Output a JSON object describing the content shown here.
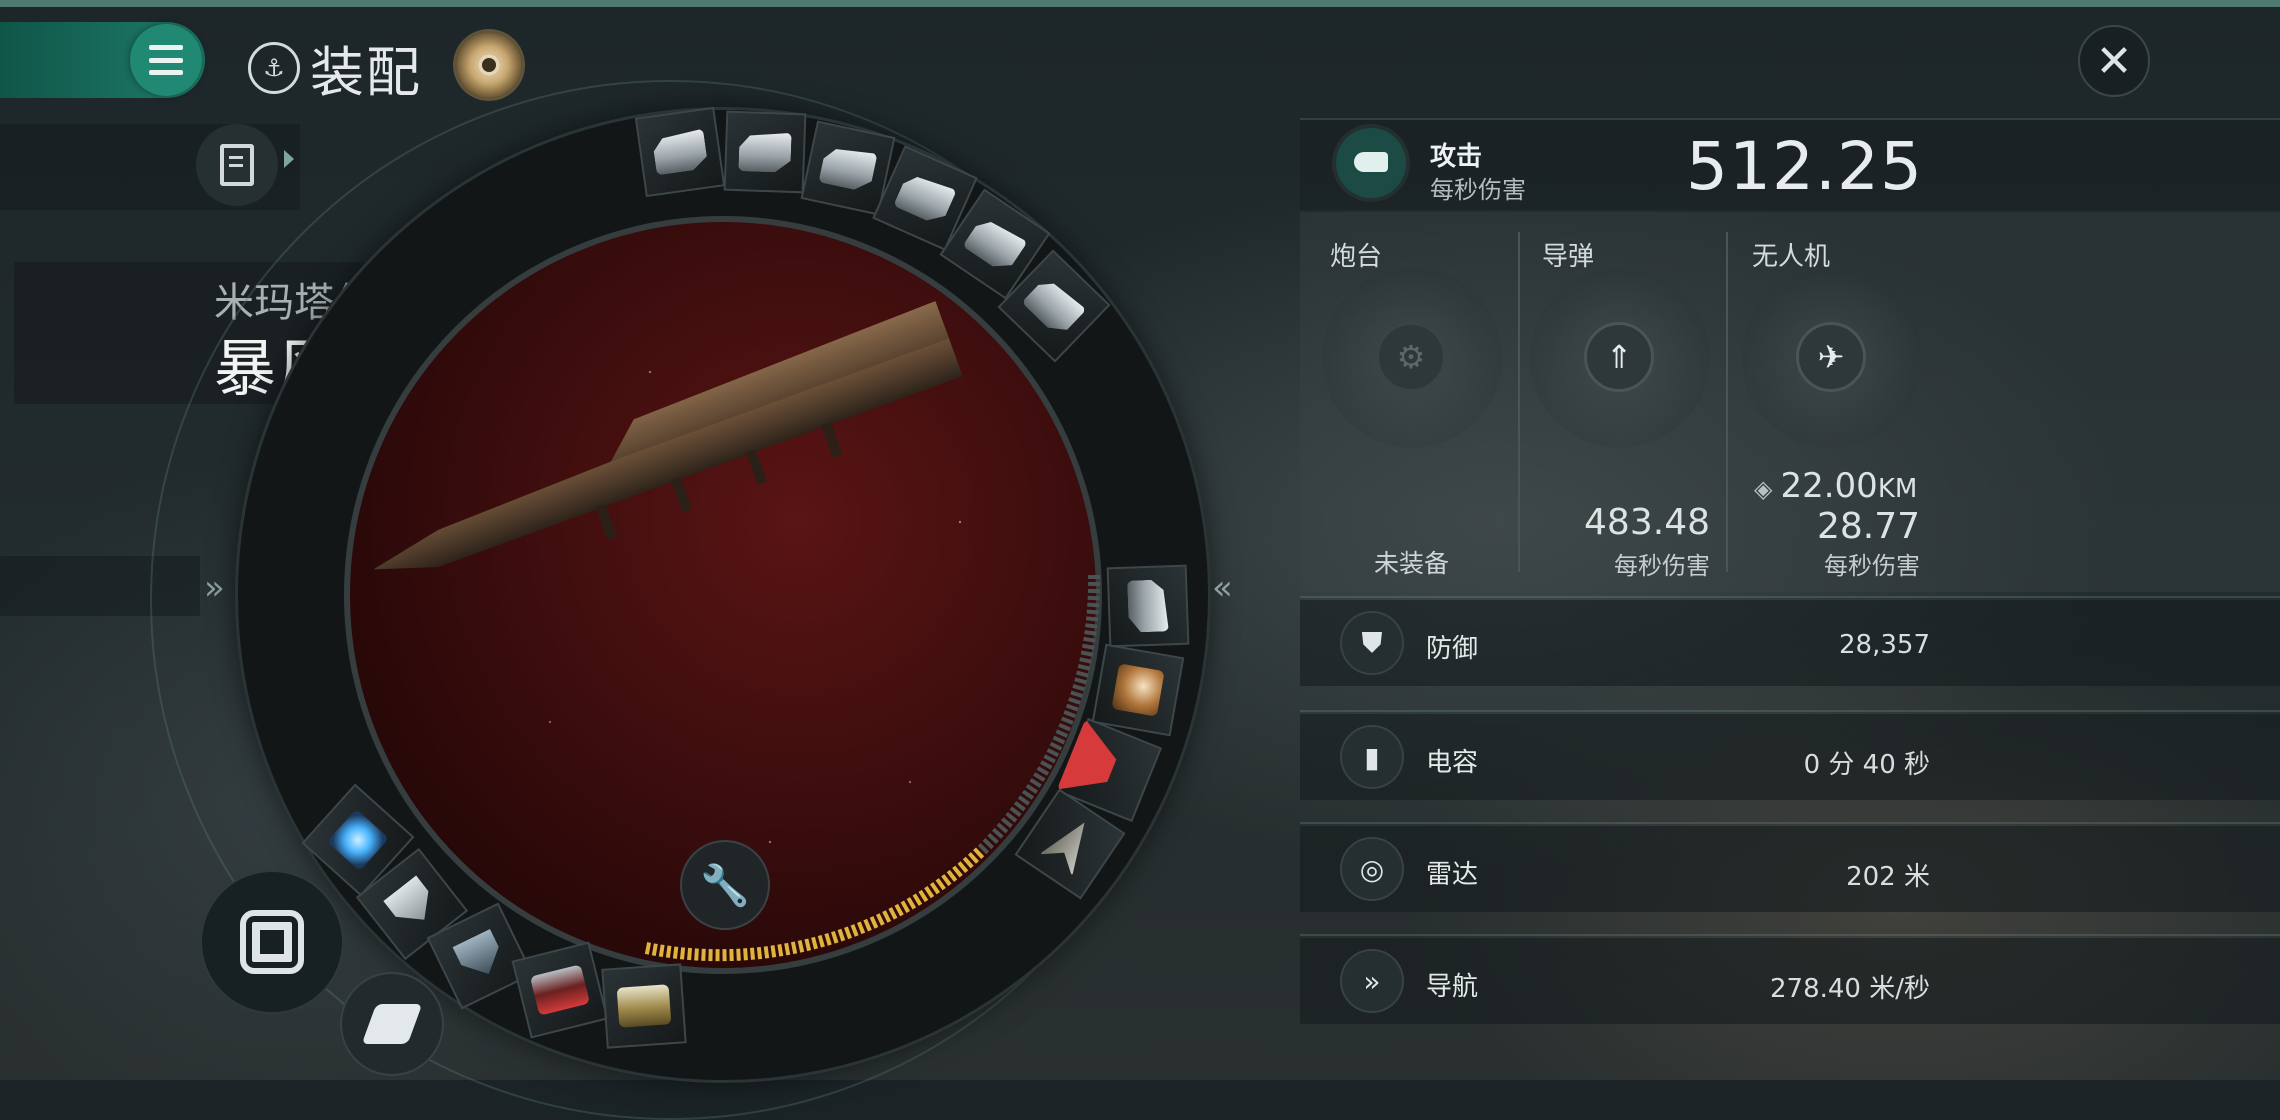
{
  "header": {
    "title": "装配",
    "title_icon": "fitting-emblem-icon",
    "close_icon": "close-icon"
  },
  "ship": {
    "class": "米玛塔尔",
    "name": "暴风级原型",
    "name_arrow": "»"
  },
  "ring": {
    "left_chevron": "»",
    "right_chevron": "«",
    "wrench_icon": "wrench-icon"
  },
  "attack": {
    "label": "攻击",
    "sub": "每秒伤害",
    "value": "512.25",
    "columns": [
      {
        "label": "炮台",
        "status": "未装备"
      },
      {
        "label": "导弹",
        "value": "483.48",
        "unit": "每秒伤害"
      },
      {
        "label": "无人机",
        "range": "22.00",
        "range_unit": "KM",
        "value": "28.77",
        "unit": "每秒伤害"
      }
    ]
  },
  "stats": [
    {
      "name": "防御",
      "value": "28,357",
      "icon": "shield-icon"
    },
    {
      "name": "电容",
      "value": "0 分 40 秒",
      "icon": "capacitor-icon"
    },
    {
      "name": "雷达",
      "value": "202 米",
      "icon": "radar-icon"
    },
    {
      "name": "导航",
      "value": "278.40 米/秒",
      "icon": "navigation-icon"
    }
  ],
  "colors": {
    "accent": "#218873",
    "topline": "#4e7a72",
    "capacitor_bar": "#e0b43c"
  }
}
